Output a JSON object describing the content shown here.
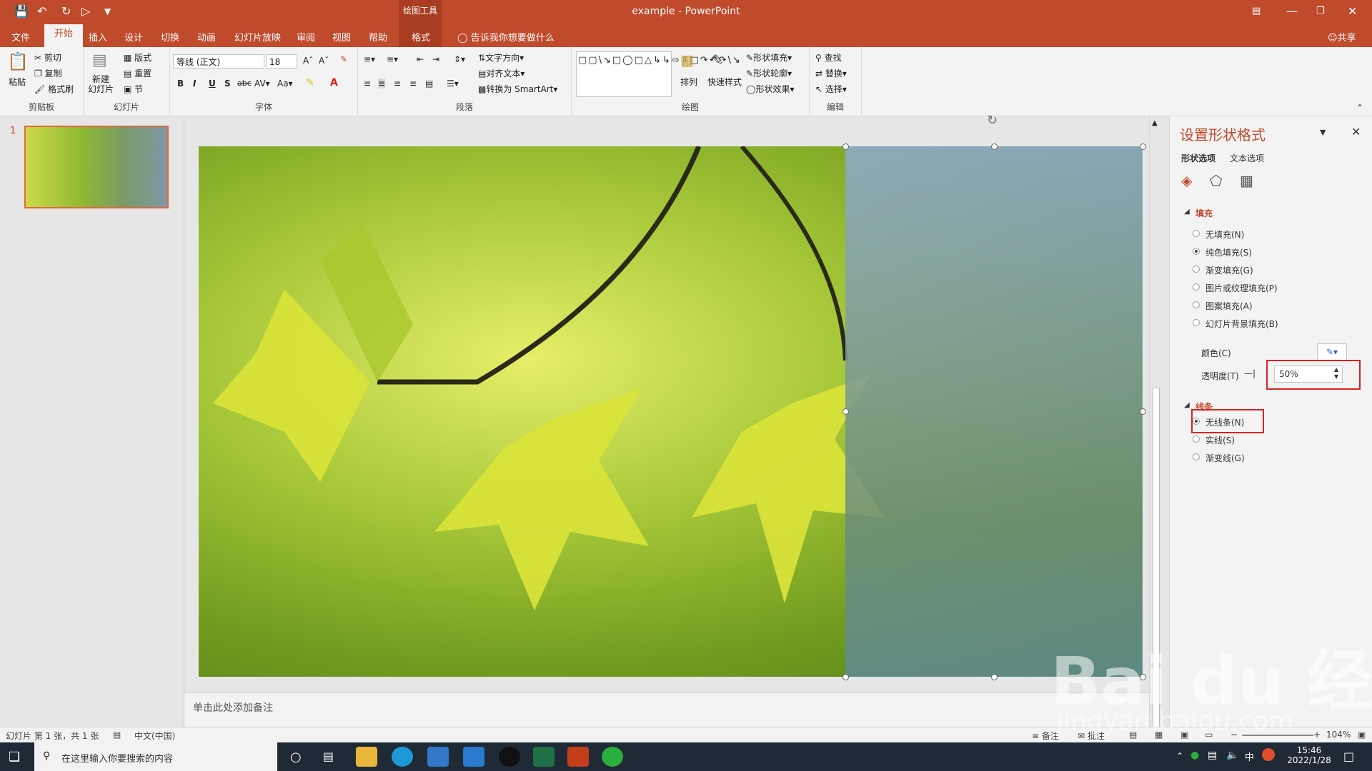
{
  "window": {
    "title": "example - PowerPoint",
    "context_group": "绘图工具",
    "share": "共享",
    "quick_access": [
      "save-icon",
      "undo-icon",
      "redo-icon",
      "start-from-beginning-icon",
      "customize-icon"
    ]
  },
  "tabs": {
    "file": "文件",
    "home": "开始",
    "insert": "插入",
    "design": "设计",
    "transitions": "切换",
    "animations": "动画",
    "slideshow": "幻灯片放映",
    "review": "审阅",
    "view": "视图",
    "help": "帮助",
    "format": "格式",
    "tell_me": "告诉我你想要做什么"
  },
  "ribbon": {
    "clipboard": {
      "label": "剪贴板",
      "paste": "粘贴",
      "cut": "剪切",
      "copy": "复制",
      "format_painter": "格式刷"
    },
    "slides": {
      "label": "幻灯片",
      "new_slide": "新建\n幻灯片",
      "layout": "版式",
      "reset": "重置",
      "section": "节"
    },
    "font": {
      "label": "字体",
      "font_name": "等线 (正文)",
      "font_size": "18",
      "bold": "B",
      "italic": "I",
      "underline": "U",
      "shadow": "S",
      "strike": "abc",
      "change_case": "Aa"
    },
    "paragraph": {
      "label": "段落",
      "text_direction": "文字方向",
      "align_text": "对齐文本",
      "smartart": "转换为 SmartArt"
    },
    "drawing": {
      "label": "绘图",
      "arrange": "排列",
      "quick_styles": "快速样式",
      "shape_fill": "形状填充",
      "shape_outline": "形状轮廓",
      "shape_effects": "形状效果"
    },
    "editing": {
      "label": "编辑",
      "find": "查找",
      "replace": "替换",
      "select": "选择"
    }
  },
  "slides_pane": {
    "slide_number": "1"
  },
  "notes": {
    "placeholder": "单击此处添加备注"
  },
  "format_pane": {
    "title": "设置形状格式",
    "tab_shape": "形状选项",
    "tab_text": "文本选项",
    "fill_section": "填充",
    "fill_options": [
      "无填充(N)",
      "纯色填充(S)",
      "渐变填充(G)",
      "图片或纹理填充(P)",
      "图案填充(A)",
      "幻灯片背景填充(B)"
    ],
    "fill_selected": 1,
    "color_label": "颜色(C)",
    "transparency_label": "透明度(T)",
    "transparency_value": "50%",
    "line_section": "线条",
    "line_options": [
      "无线条(N)",
      "实线(S)",
      "渐变线(G)"
    ],
    "line_selected": 0
  },
  "status": {
    "slide_info": "幻灯片 第 1 张，共 1 张",
    "language": "中文(中国)",
    "notes_btn": "备注",
    "comments_btn": "批注",
    "zoom": "104%"
  },
  "taskbar": {
    "search_placeholder": "在这里输入你要搜索的内容",
    "time": "15:46",
    "date": "2022/1/28",
    "ime": "中"
  },
  "watermark": {
    "brand": "Bai du 经验",
    "url": "jingyan.baidu.com"
  },
  "colors": {
    "accent": "#c04a2c",
    "highlight_box": "#e02020"
  }
}
